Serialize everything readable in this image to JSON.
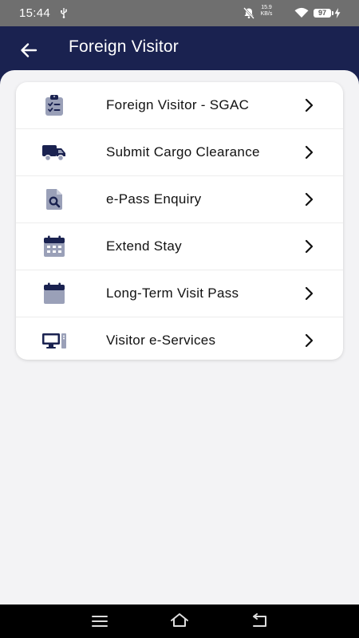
{
  "status_bar": {
    "time": "15:44",
    "net_speed_value": "15.9",
    "net_speed_unit": "KB/s",
    "battery_level": "97",
    "icons": [
      "usb-icon",
      "mute-icon",
      "wifi-icon",
      "charging-icon"
    ]
  },
  "header": {
    "title": "Foreign Visitor",
    "back_icon": "arrow-left-icon"
  },
  "menu": {
    "items": [
      {
        "label": "Foreign Visitor - SGAC",
        "icon": "clipboard-checklist-icon"
      },
      {
        "label": "Submit Cargo Clearance",
        "icon": "truck-icon"
      },
      {
        "label": "e-Pass Enquiry",
        "icon": "document-search-icon"
      },
      {
        "label": "Extend Stay",
        "icon": "calendar-grid-icon"
      },
      {
        "label": "Long-Term Visit Pass",
        "icon": "calendar-icon"
      },
      {
        "label": "Visitor e-Services",
        "icon": "desktop-computer-icon"
      }
    ],
    "chevron_icon": "chevron-right-icon"
  },
  "colors": {
    "header_bg": "#1a2250",
    "icon_dark": "#1a2250",
    "icon_light": "#9aa0b8",
    "content_bg": "#f3f3f5",
    "card_bg": "#ffffff"
  },
  "nav_bar": {
    "icons": [
      "menu-icon",
      "home-icon",
      "back-icon"
    ]
  }
}
